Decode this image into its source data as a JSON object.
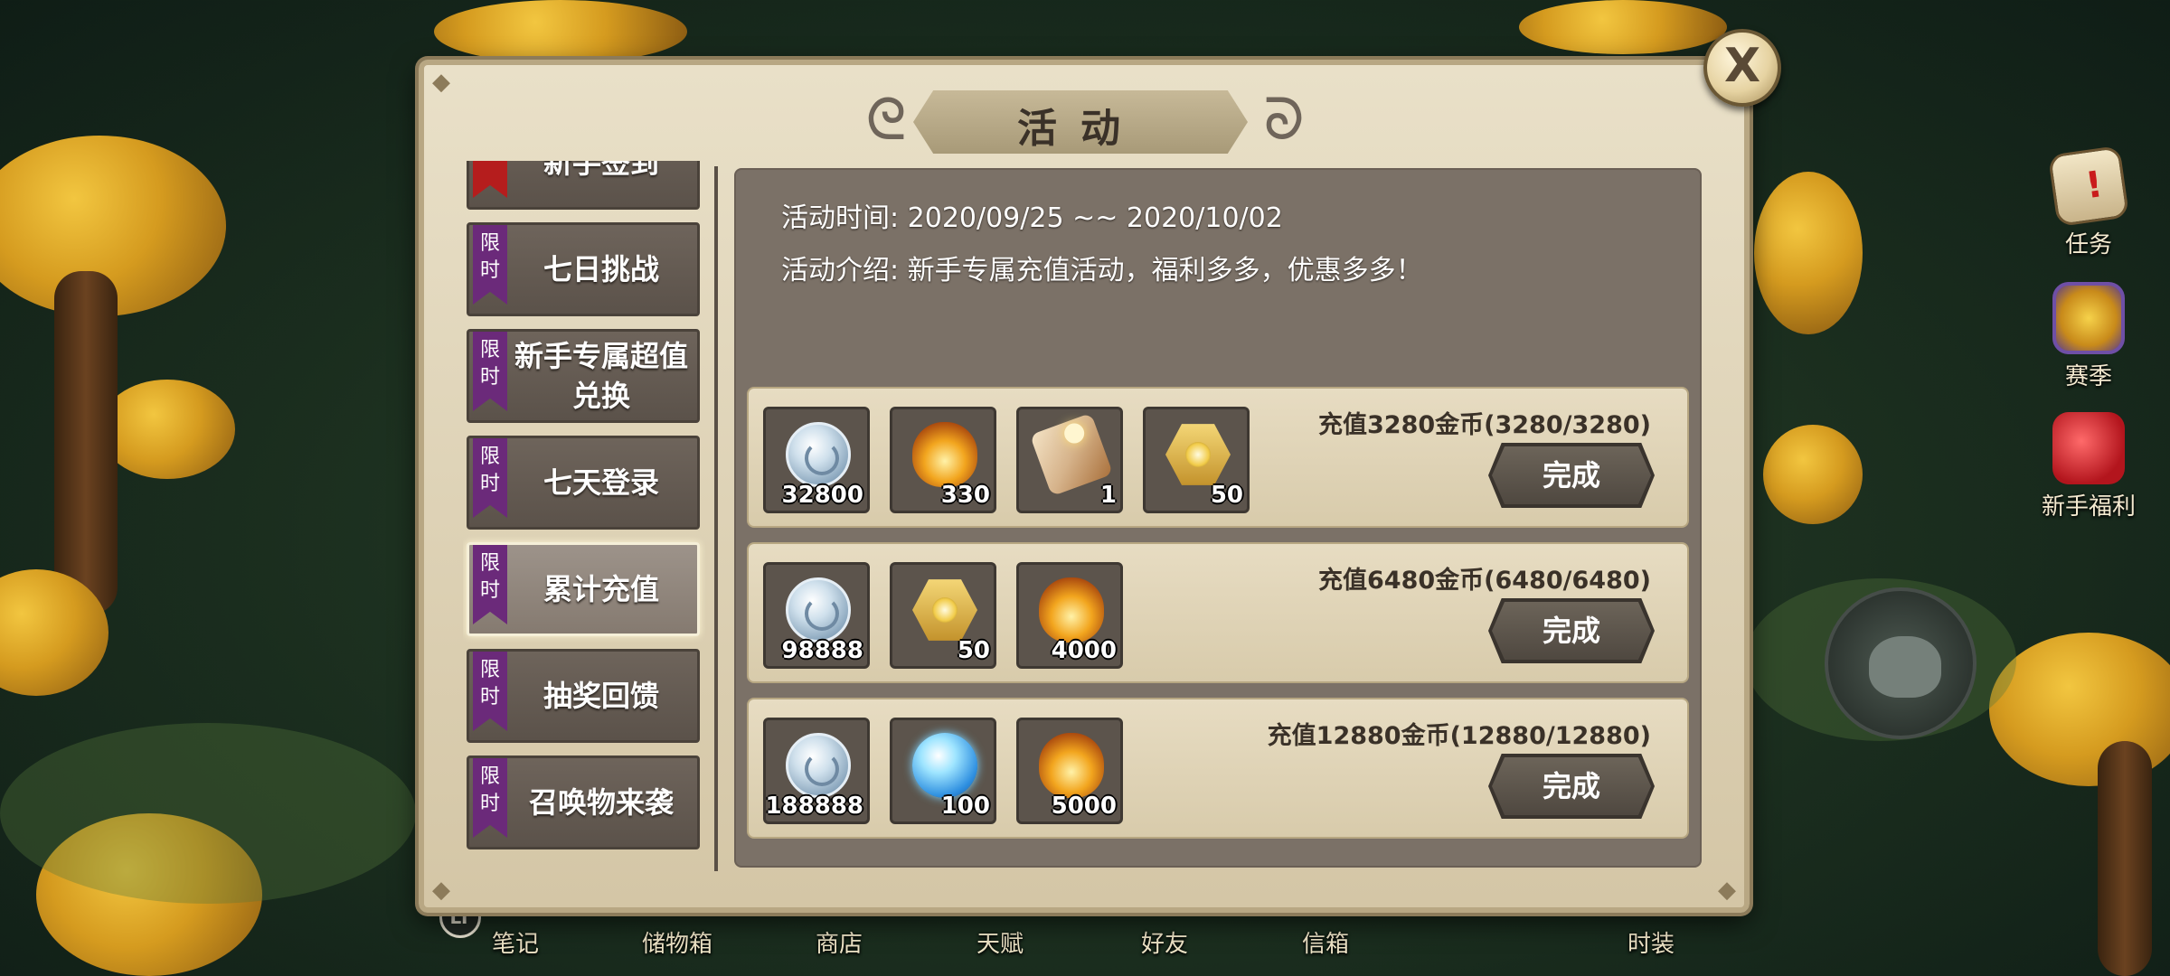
{
  "panel": {
    "title": "活动",
    "activity_time": "活动时间: 2020/09/25 ~~ 2020/10/02",
    "activity_intro": "活动介绍: 新手专属充值活动，福利多多，优惠多多！",
    "close_label": "X"
  },
  "tabs": [
    {
      "badge": "",
      "label": "新手签到"
    },
    {
      "badge": "限时",
      "label": "七日挑战"
    },
    {
      "badge": "限时",
      "label": "新手专属超值兑换"
    },
    {
      "badge": "限时",
      "label": "七天登录"
    },
    {
      "badge": "限时",
      "label": "累计充值",
      "selected": true
    },
    {
      "badge": "限时",
      "label": "抽奖回馈"
    },
    {
      "badge": "限时",
      "label": "召唤物来袭"
    }
  ],
  "rewards": [
    {
      "requirement": "充值3280金币(3280/3280)",
      "button": "完成",
      "items": [
        {
          "icon": "silver-coin-icon",
          "qty": "32800"
        },
        {
          "icon": "fire-egg-icon",
          "qty": "330"
        },
        {
          "icon": "scroll-icon",
          "qty": "1"
        },
        {
          "icon": "gold-hex-gem-icon",
          "qty": "50"
        }
      ]
    },
    {
      "requirement": "充值6480金币(6480/6480)",
      "button": "完成",
      "items": [
        {
          "icon": "silver-coin-icon",
          "qty": "98888"
        },
        {
          "icon": "gold-hex-gem-icon",
          "qty": "50"
        },
        {
          "icon": "fire-egg-icon",
          "qty": "4000"
        }
      ]
    },
    {
      "requirement": "充值12880金币(12880/12880)",
      "button": "完成",
      "items": [
        {
          "icon": "silver-coin-icon",
          "qty": "188888"
        },
        {
          "icon": "blue-orb-icon",
          "qty": "100"
        },
        {
          "icon": "fire-egg-icon",
          "qty": "5000"
        }
      ]
    }
  ],
  "side_hud": [
    {
      "label": "任务",
      "icon": "task-scroll-icon"
    },
    {
      "label": "赛季",
      "icon": "season-trophy-icon"
    },
    {
      "label": "新手福利",
      "icon": "gift-bag-icon"
    }
  ],
  "bottom_bar": [
    {
      "label": "笔记"
    },
    {
      "label": "储物箱"
    },
    {
      "label": "商店"
    },
    {
      "label": "天赋"
    },
    {
      "label": "好友"
    },
    {
      "label": "信箱"
    },
    {
      "label": "时装"
    }
  ],
  "lt_badge": "LT"
}
